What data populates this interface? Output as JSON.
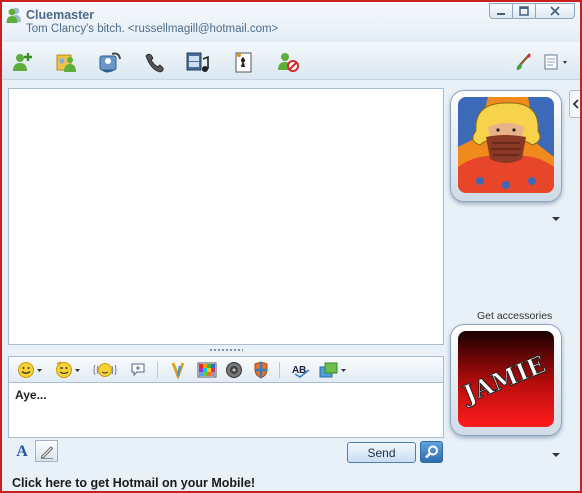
{
  "titlebar": {
    "contact_name": "Cluemaster",
    "contact_status": "Tom Clancy's bitch.  <russellmagill@hotmail.com>"
  },
  "compose": {
    "text": "Aye..."
  },
  "buttons": {
    "send_label": "Send"
  },
  "statusbar": {
    "link_text": "Click here to get Hotmail on your Mobile!"
  },
  "sidebar": {
    "accessories_label": "Get accessories",
    "my_picture_text": "JAMIE"
  },
  "toolbar_icons": [
    "invite-contact-icon",
    "share-files-icon",
    "webcam-icon",
    "call-icon",
    "activities-icon",
    "games-icon",
    "block-icon",
    "paint-brush-icon",
    "menu-icon"
  ],
  "compose_icons": [
    "emoticon-icon",
    "wink-icon",
    "nudge-icon",
    "voice-clip-icon",
    "background-icon",
    "font-icon",
    "spell-check-icon",
    "window-menu-icon"
  ],
  "colors": {
    "window_border": "#c8201e",
    "window_bg": "#e9f1f8",
    "title_text": "#4d6b8a"
  }
}
